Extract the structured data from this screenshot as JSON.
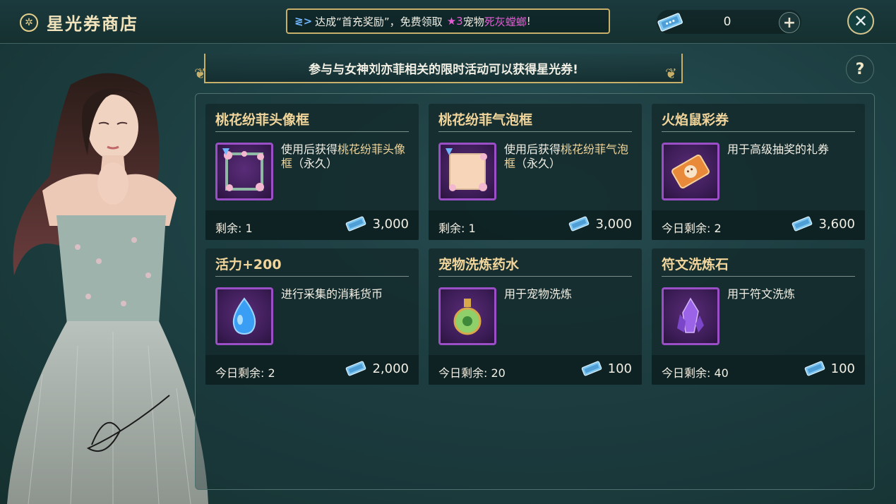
{
  "header": {
    "title": "星光券商店",
    "promo": {
      "arrow": "≷>",
      "text_before": "达成“首充奖励”，免费领取",
      "star_count": "★3",
      "text_pet": "宠物",
      "pet_name": "死灰螳螂",
      "text_end": "!"
    },
    "currency_amount": "0",
    "plus_label": "+",
    "close_label": "✕"
  },
  "banner": {
    "text": "参与与女神刘亦菲相关的限时活动可以获得星光券!"
  },
  "help_label": "?",
  "items": [
    {
      "name": "桃花纷菲头像框",
      "desc_prefix": "使用后获得",
      "desc_highlight": "桃花纷菲头像框",
      "desc_suffix": "（永久）",
      "remain_label": "剩余:",
      "remain": "1",
      "price": "3,000",
      "icon": "peach-avatar-frame-icon"
    },
    {
      "name": "桃花纷菲气泡框",
      "desc_prefix": "使用后获得",
      "desc_highlight": "桃花纷菲气泡框",
      "desc_suffix": "（永久）",
      "remain_label": "剩余:",
      "remain": "1",
      "price": "3,000",
      "icon": "peach-bubble-frame-icon"
    },
    {
      "name": "火焰鼠彩券",
      "desc_prefix": "用于高级抽奖的礼券",
      "desc_highlight": "",
      "desc_suffix": "",
      "remain_label": "今日剩余:",
      "remain": "2",
      "price": "3,600",
      "icon": "fire-rat-ticket-icon"
    },
    {
      "name": "活力+200",
      "desc_prefix": "进行采集的消耗货币",
      "desc_highlight": "",
      "desc_suffix": "",
      "remain_label": "今日剩余:",
      "remain": "2",
      "price": "2,000",
      "icon": "energy-drop-icon"
    },
    {
      "name": "宠物洗炼药水",
      "desc_prefix": "用于宠物洗炼",
      "desc_highlight": "",
      "desc_suffix": "",
      "remain_label": "今日剩余:",
      "remain": "20",
      "price": "100",
      "icon": "pet-potion-icon"
    },
    {
      "name": "符文洗炼石",
      "desc_prefix": "用于符文洗炼",
      "desc_highlight": "",
      "desc_suffix": "",
      "remain_label": "今日剩余:",
      "remain": "40",
      "price": "100",
      "icon": "rune-crystal-icon"
    }
  ],
  "colors": {
    "accent_gold": "#f1d59a",
    "frame_purple": "#9b4fc7",
    "pet_pink": "#e85bd6"
  }
}
